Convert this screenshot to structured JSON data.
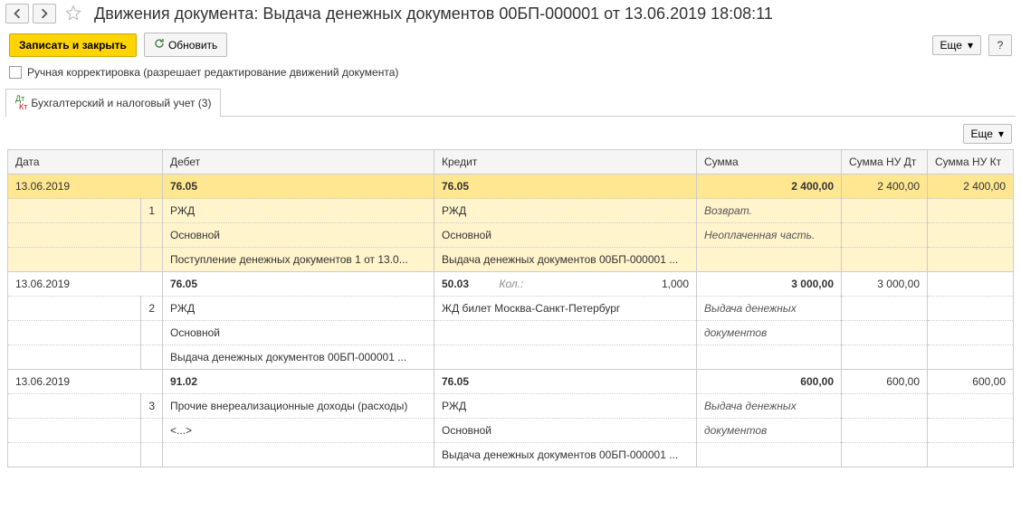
{
  "header": {
    "title": "Движения документа: Выдача денежных документов 00БП-000001 от 13.06.2019 18:08:11"
  },
  "buttons": {
    "save_close": "Записать и закрыть",
    "refresh": "Обновить",
    "more": "Еще",
    "help": "?"
  },
  "checkbox": {
    "label": "Ручная корректировка (разрешает редактирование движений документа)"
  },
  "tab": {
    "label": "Бухгалтерский и налоговый учет (3)"
  },
  "columns": {
    "date": "Дата",
    "debit": "Дебет",
    "credit": "Кредит",
    "sum": "Сумма",
    "sum_nu_dt": "Сумма НУ Дт",
    "sum_nu_kt": "Сумма НУ Кт"
  },
  "rows": [
    {
      "no": "1",
      "date": "13.06.2019",
      "debit_acc": "76.05",
      "credit_acc": "76.05",
      "sum": "2 400,00",
      "sum_nu_dt": "2 400,00",
      "sum_nu_kt": "2 400,00",
      "debit_sub1": "РЖД",
      "debit_sub2": "Основной",
      "debit_sub3": "Поступление денежных документов 1 от 13.0...",
      "credit_sub1": "РЖД",
      "credit_sub2": "Основной",
      "credit_sub3": "Выдача денежных документов 00БП-000001 ...",
      "comment1": "Возврат.",
      "comment2": "Неоплаченная часть."
    },
    {
      "no": "2",
      "date": "13.06.2019",
      "debit_acc": "76.05",
      "credit_acc": "50.03",
      "kol_label": "Кол.:",
      "kol_val": "1,000",
      "sum": "3 000,00",
      "sum_nu_dt": "3 000,00",
      "sum_nu_kt": "",
      "debit_sub1": "РЖД",
      "debit_sub2": "Основной",
      "debit_sub3": "Выдача денежных документов 00БП-000001 ...",
      "credit_sub1": "ЖД билет Москва-Санкт-Петербург",
      "comment1": "Выдача денежных",
      "comment2": "документов"
    },
    {
      "no": "3",
      "date": "13.06.2019",
      "debit_acc": "91.02",
      "credit_acc": "76.05",
      "sum": "600,00",
      "sum_nu_dt": "600,00",
      "sum_nu_kt": "600,00",
      "debit_sub1": "Прочие внереализационные доходы (расходы)",
      "debit_sub2": "<...>",
      "credit_sub1": "РЖД",
      "credit_sub2": "Основной",
      "credit_sub3": "Выдача денежных документов 00БП-000001 ...",
      "comment1": "Выдача денежных",
      "comment2": "документов"
    }
  ]
}
